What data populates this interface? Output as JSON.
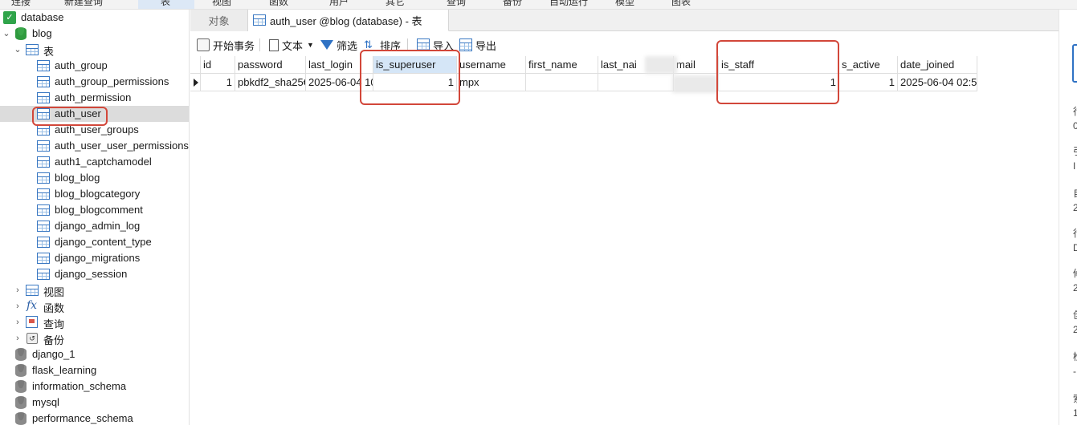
{
  "topbar": {
    "items": [
      "连接",
      "新建查询",
      "表",
      "视图",
      "函数",
      "用户",
      "其它",
      "查询",
      "备份",
      "自动运行",
      "模型",
      "图表"
    ]
  },
  "sidebar": {
    "connection": "database",
    "database": "blog",
    "tables_group": "表",
    "tables": [
      "auth_group",
      "auth_group_permissions",
      "auth_permission",
      "auth_user",
      "auth_user_groups",
      "auth_user_user_permissions",
      "auth1_captchamodel",
      "blog_blog",
      "blog_blogcategory",
      "blog_blogcomment",
      "django_admin_log",
      "django_content_type",
      "django_migrations",
      "django_session"
    ],
    "selected_table": "auth_user",
    "groups": [
      {
        "label": "视图",
        "icon": "view-icon"
      },
      {
        "label": "函数",
        "icon": "function-icon"
      },
      {
        "label": "查询",
        "icon": "query-icon"
      },
      {
        "label": "备份",
        "icon": "backup-icon"
      }
    ],
    "databases": [
      "django_1",
      "flask_learning",
      "information_schema",
      "mysql",
      "performance_schema"
    ]
  },
  "tabs": {
    "objects": "对象",
    "active": "auth_user @blog (database) - 表"
  },
  "toolbar": {
    "begin_transaction": "开始事务",
    "text": "文本",
    "filter": "筛选",
    "sort": "排序",
    "import": "导入",
    "export": "导出"
  },
  "grid": {
    "columns": [
      "id",
      "password",
      "last_login",
      "is_superuser",
      "username",
      "first_name",
      "last_nai",
      "mail",
      "is_staff",
      "s_active",
      "date_joined"
    ],
    "highlighted_column": "is_superuser",
    "rows": [
      [
        "1",
        "pbkdf2_sha25€",
        "2025-06-04 10",
        "1",
        "mpx",
        "",
        "",
        "",
        "1",
        "1",
        "2025-06-04 02:5"
      ]
    ]
  },
  "right_panel": {
    "chars": [
      "行",
      "0",
      "引",
      "I",
      "自",
      "2",
      "行",
      "D",
      "修",
      "2",
      "创",
      "2",
      "检",
      "-",
      "索",
      "1"
    ]
  },
  "colors": {
    "callout": "#d2473a",
    "selection": "#dcdcdc",
    "header_highlight": "#d5e6f7",
    "accent": "#3a78c2"
  }
}
